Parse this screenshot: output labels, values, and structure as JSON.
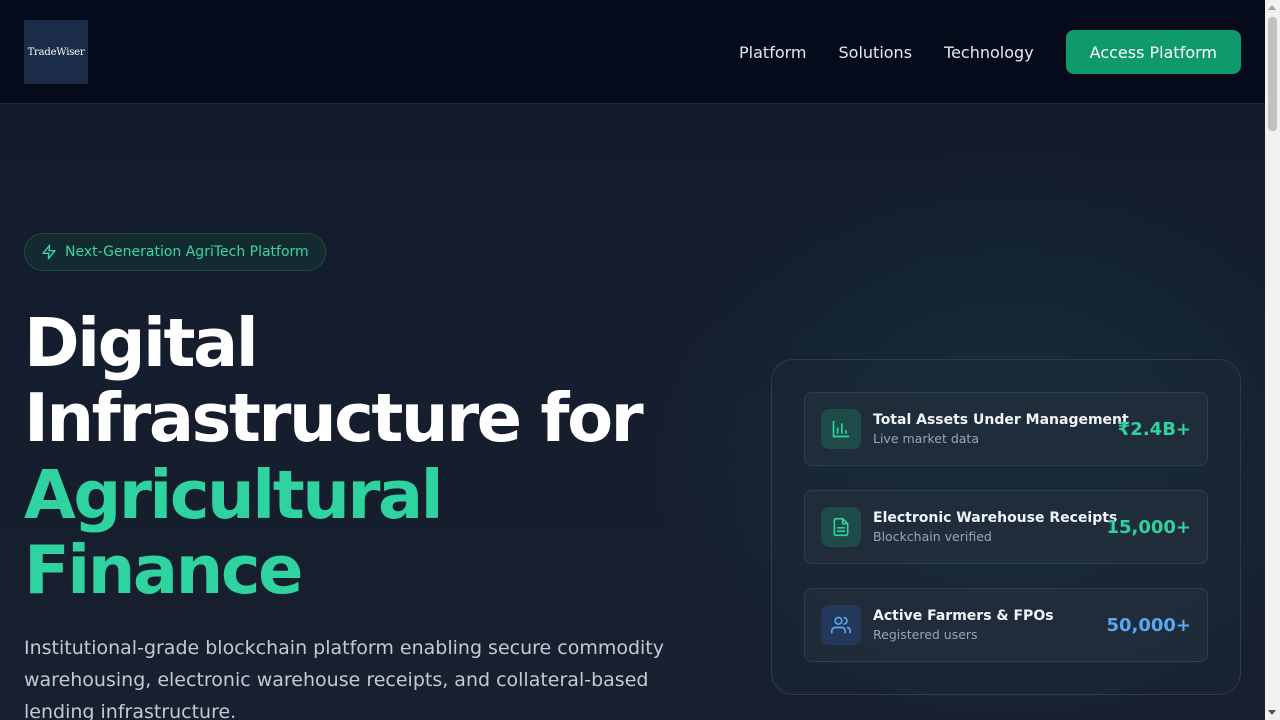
{
  "header": {
    "logo_text": "TradeWiser",
    "nav": [
      {
        "label": "Platform"
      },
      {
        "label": "Solutions"
      },
      {
        "label": "Technology"
      }
    ],
    "cta_label": "Access Platform"
  },
  "hero": {
    "badge": {
      "icon": "lightning-icon",
      "label": "Next-Generation AgriTech Platform"
    },
    "title_line1": "Digital",
    "title_line2": "Infrastructure for",
    "title_accent_line1": "Agricultural",
    "title_accent_line2": "Finance",
    "description": "Institutional-grade blockchain platform enabling secure commodity warehousing, electronic warehouse receipts, and collateral-based lending infrastructure."
  },
  "stats": [
    {
      "icon": "bar-chart-icon",
      "title": "Total Assets Under Management",
      "subtitle": "Live market data",
      "value": "₹2.4B+",
      "color": "#2ed3a0"
    },
    {
      "icon": "document-icon",
      "title": "Electronic Warehouse Receipts",
      "subtitle": "Blockchain verified",
      "value": "15,000+",
      "color": "#2ed3a0"
    },
    {
      "icon": "users-icon",
      "title": "Active Farmers & FPOs",
      "subtitle": "Registered users",
      "value": "50,000+",
      "color": "#5aa7f2"
    }
  ],
  "colors": {
    "accent": "#2ed3a0",
    "cta": "#0f9a6c",
    "header_bg": "#050b1a",
    "blue_accent": "#5aa7f2"
  }
}
